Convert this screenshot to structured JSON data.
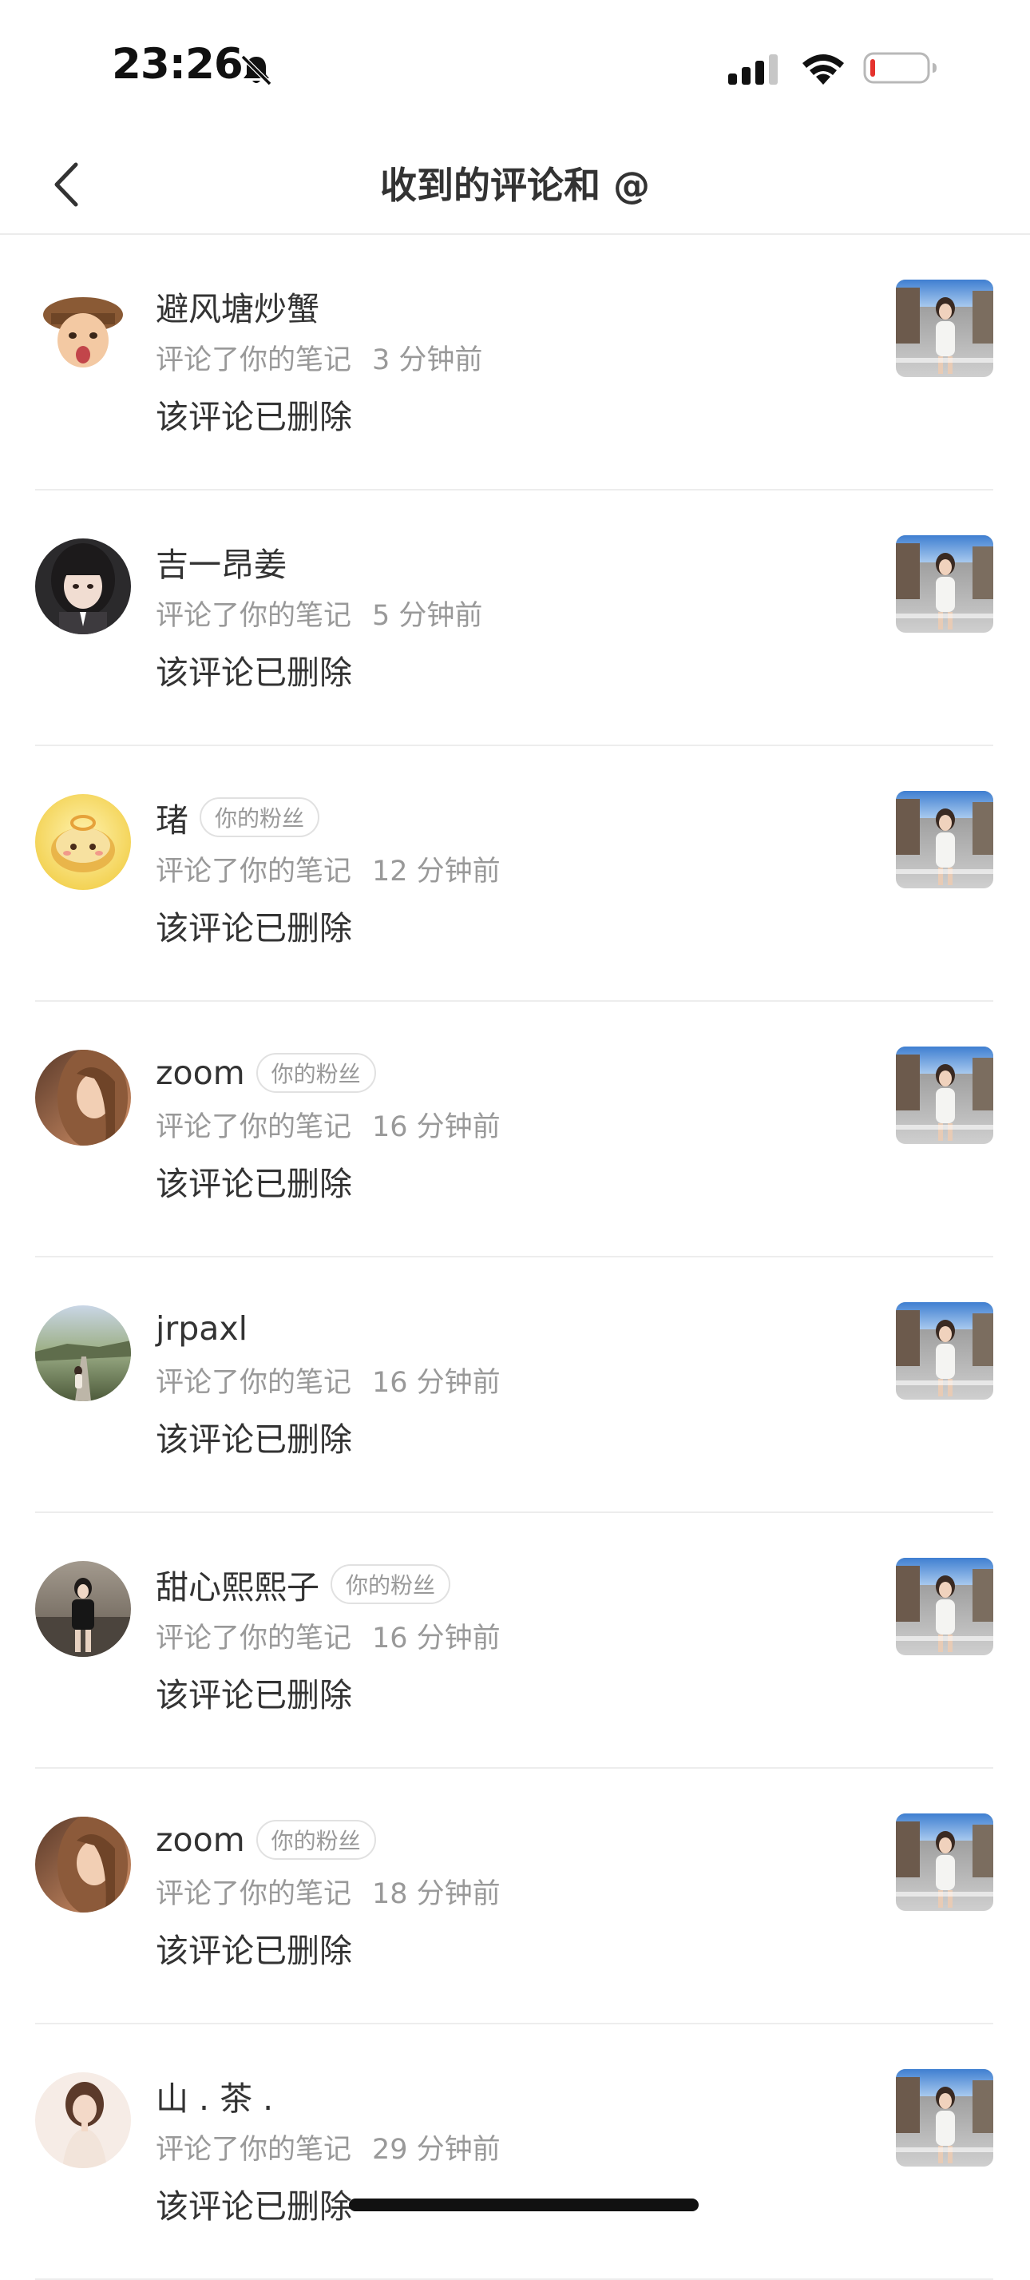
{
  "status_bar": {
    "time": "23:26",
    "icons": [
      "bell-mute-icon",
      "cellular-signal-icon",
      "wifi-icon",
      "battery-low-icon"
    ],
    "battery_level": 0.08
  },
  "nav": {
    "back_icon": "chevron-left-icon",
    "title": "收到的评论和 @"
  },
  "colors": {
    "text_primary": "#333333",
    "text_secondary": "#999999",
    "badge_border": "#e1e1e1",
    "divider": "#ededed",
    "battery_low": "#e5322d"
  },
  "comments": [
    {
      "user": "避风塘炒蟹",
      "badge": "",
      "action": "评论了你的笔记",
      "time": "3 分钟前",
      "text": "该评论已删除",
      "avatar": "cartoon-girl-avatar"
    },
    {
      "user": "吉一昂姜",
      "badge": "",
      "action": "评论了你的笔记",
      "time": "5 分钟前",
      "text": "该评论已删除",
      "avatar": "girl-selfie-avatar"
    },
    {
      "user": "琽",
      "badge": "你的粉丝",
      "action": "评论了你的笔记",
      "time": "12 分钟前",
      "text": "该评论已删除",
      "avatar": "yellow-cartoon-avatar"
    },
    {
      "user": "zoom",
      "badge": "你的粉丝",
      "action": "评论了你的笔记",
      "time": "16 分钟前",
      "text": "该评论已删除",
      "avatar": "long-hair-girl-avatar"
    },
    {
      "user": "jrpaxl",
      "badge": "",
      "action": "评论了你的笔记",
      "time": "16 分钟前",
      "text": "该评论已删除",
      "avatar": "road-landscape-avatar"
    },
    {
      "user": "甜心熙熙子",
      "badge": "你的粉丝",
      "action": "评论了你的笔记",
      "time": "16 分钟前",
      "text": "该评论已删除",
      "avatar": "girl-street-avatar"
    },
    {
      "user": "zoom",
      "badge": "你的粉丝",
      "action": "评论了你的笔记",
      "time": "18 分钟前",
      "text": "该评论已删除",
      "avatar": "long-hair-girl-avatar"
    },
    {
      "user": "山 . 茶 .",
      "badge": "",
      "action": "评论了你的笔记",
      "time": "29 分钟前",
      "text": "该评论已删除",
      "avatar": "girl-portrait-avatar"
    }
  ]
}
